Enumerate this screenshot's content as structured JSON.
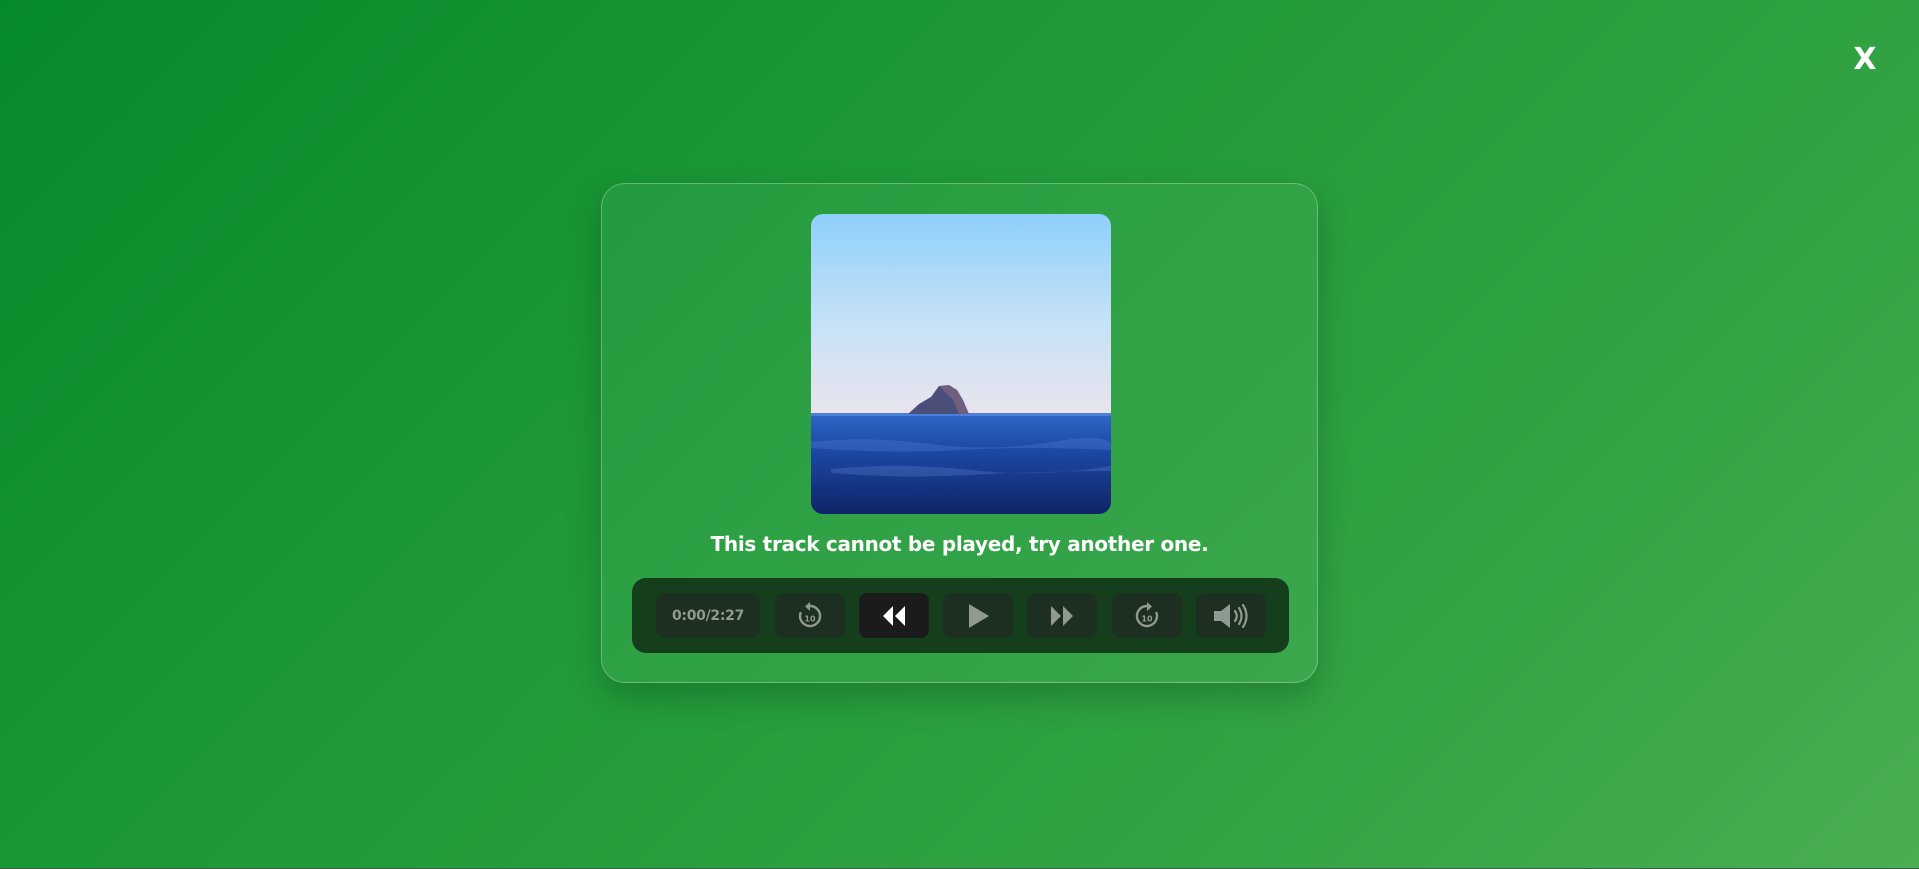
{
  "close": {
    "label": "X"
  },
  "player": {
    "message": "This track cannot be played, try another one.",
    "time_display": "0:00/2:27",
    "artwork_description": "island at sea",
    "controls": [
      {
        "name": "rewind-10-button",
        "icon": "rewind-10-icon",
        "badge": "10"
      },
      {
        "name": "previous-track-button",
        "icon": "double-chevron-left-icon",
        "state": "active"
      },
      {
        "name": "play-button",
        "icon": "play-icon"
      },
      {
        "name": "next-track-button",
        "icon": "double-chevron-right-icon"
      },
      {
        "name": "forward-10-button",
        "icon": "forward-10-icon",
        "badge": "10"
      },
      {
        "name": "volume-button",
        "icon": "speaker-icon"
      }
    ]
  },
  "colors": {
    "background_start": "#058a2a",
    "background_end": "#4aad52",
    "controls_bar": "#143e1c",
    "control_button": "#1d2f20",
    "control_button_active": "#1b1b1b",
    "icon_dim": "#8f9a90",
    "icon_active": "#ffffff"
  }
}
